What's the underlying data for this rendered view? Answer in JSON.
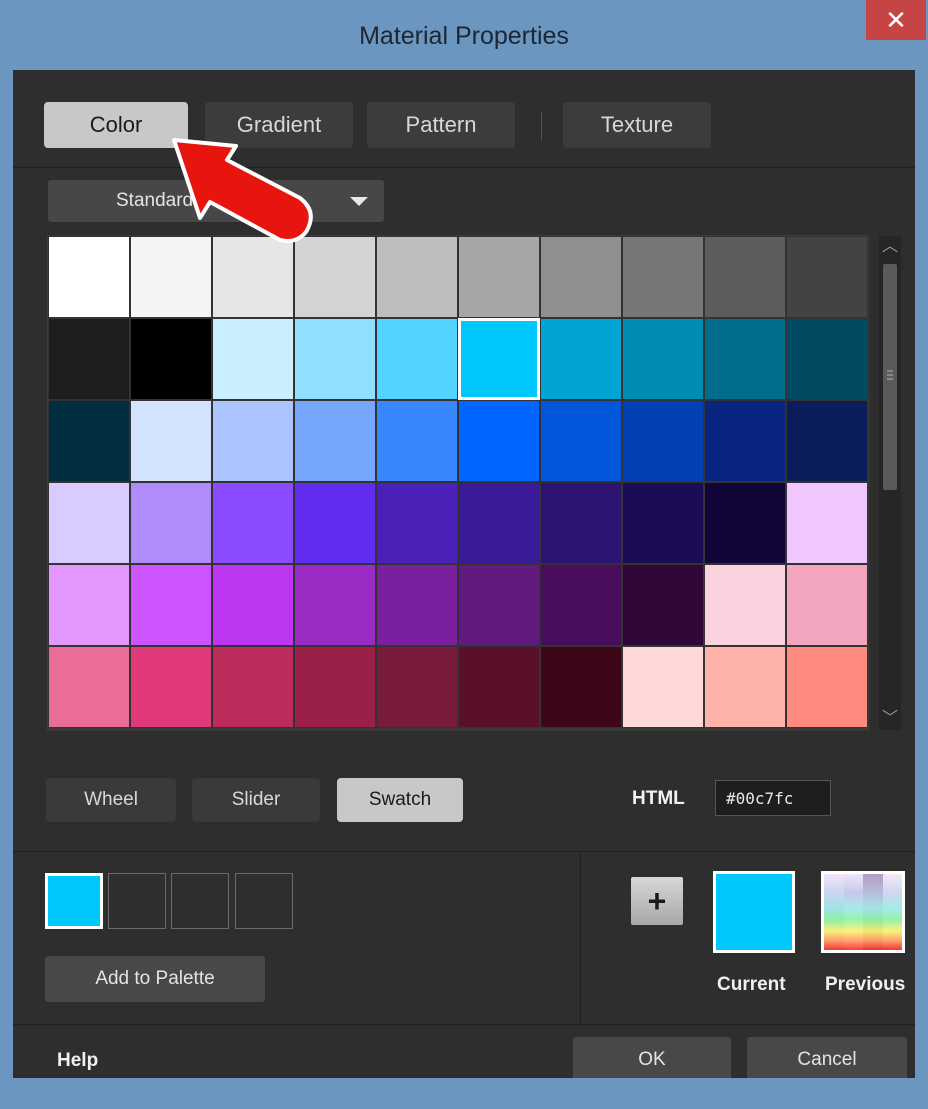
{
  "window": {
    "title": "Material Properties",
    "close_glyph": "✕"
  },
  "tabs": [
    {
      "label": "Color",
      "active": true
    },
    {
      "label": "Gradient",
      "active": false
    },
    {
      "label": "Pattern",
      "active": false
    },
    {
      "label": "Texture",
      "active": false
    }
  ],
  "palette_dropdown": {
    "selected": "Standard Pa"
  },
  "swatches": [
    [
      "#ffffff",
      "#f4f4f4",
      "#e6e6e6",
      "#d3d3d3",
      "#bdbdbd",
      "#a6a6a6",
      "#8f8f8f",
      "#767676",
      "#5d5d5d",
      "#434343"
    ],
    [
      "#1e1e1e",
      "#000000",
      "#ccefff",
      "#8fe0ff",
      "#53d3ff",
      "#00c7fc",
      "#00a5d6",
      "#008db3",
      "#006c8e",
      "#004b62"
    ],
    [
      "#022f40",
      "#d3e2ff",
      "#a9c4ff",
      "#77a6ff",
      "#3887ff",
      "#0066ff",
      "#0057d9",
      "#0040b0",
      "#0a2482",
      "#0b1e5a"
    ],
    [
      "#d9cbff",
      "#b08cfb",
      "#8c4bff",
      "#602cf0",
      "#4b20b8",
      "#3a1a96",
      "#2d1473",
      "#1c0b55",
      "#12053a",
      "#f0c8ff"
    ],
    [
      "#e496ff",
      "#cc55ff",
      "#bd36f2",
      "#9a2bc4",
      "#7a209f",
      "#621a80",
      "#4a0d5c",
      "#2f0638",
      "#f9d2de",
      "#f3a5bd"
    ],
    [
      "#ea6d97",
      "#e03a7a",
      "#bb2c5c",
      "#9b2048",
      "#781a3c",
      "#5c0f2a",
      "#3d0718",
      "#ffd9d8",
      "#ffb2a8",
      "#ff8a7e"
    ]
  ],
  "selected_swatch": "#00c7fc",
  "modes": [
    {
      "label": "Wheel",
      "active": false
    },
    {
      "label": "Slider",
      "active": false
    },
    {
      "label": "Swatch",
      "active": true
    }
  ],
  "html_field": {
    "label": "HTML",
    "value": "#00c7fc"
  },
  "custom_palette": {
    "slots": [
      "#00c7fc",
      "",
      "",
      ""
    ],
    "add_label": "Add to Palette"
  },
  "current_color": {
    "label": "Current",
    "value": "#00c7fc"
  },
  "previous_color": {
    "label": "Previous"
  },
  "footer": {
    "help": "Help",
    "ok": "OK",
    "cancel": "Cancel"
  },
  "colors": {
    "accent": "#00c7fc",
    "dialog_bg": "#2e2e2e",
    "title_bar": "#6b96c0",
    "close_button": "#c74444",
    "annotation_arrow": "#e8150e"
  }
}
